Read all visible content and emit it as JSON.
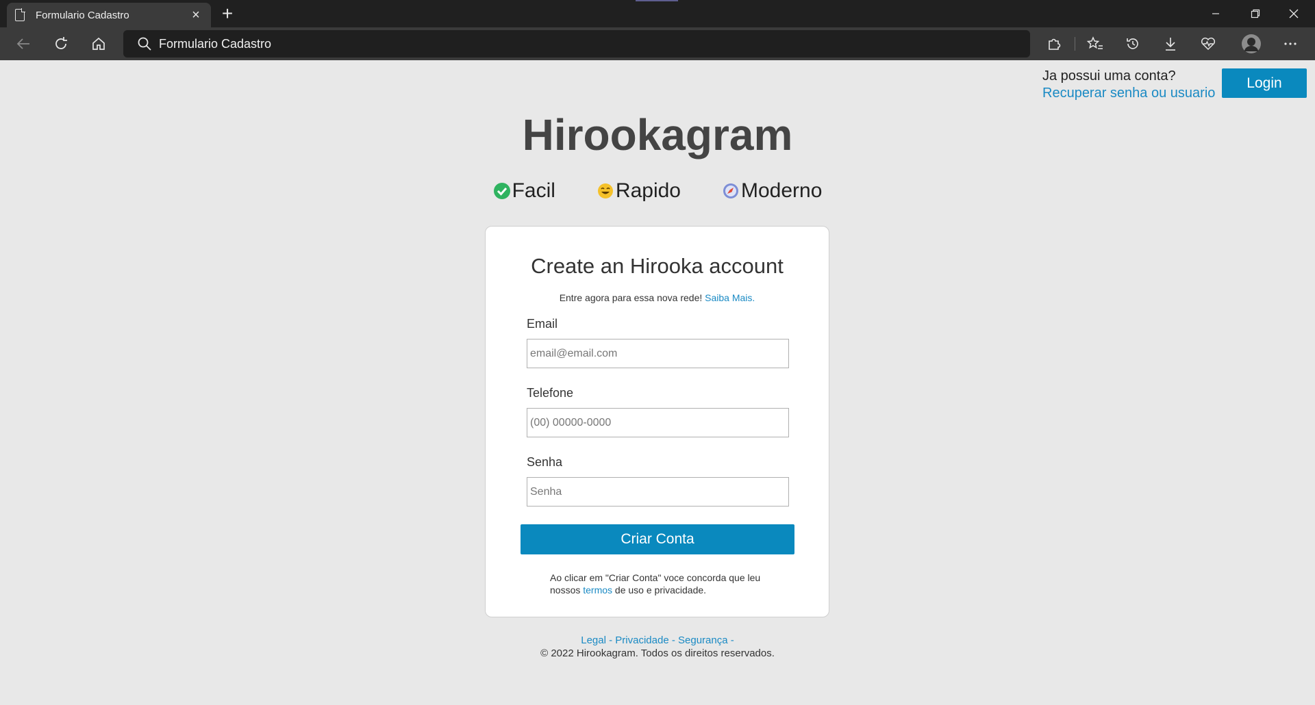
{
  "browser": {
    "tab_title": "Formulario Cadastro",
    "address_text": "Formulario Cadastro"
  },
  "header": {
    "question": "Ja possui uma conta?",
    "recover_link": "Recuperar senha ou usuario",
    "login_label": "Login"
  },
  "brand": "Hirookagram",
  "features": [
    {
      "label": "Facil",
      "icon": "check-circle-icon",
      "color": "#2fb360"
    },
    {
      "label": "Rapido",
      "icon": "smiley-icon",
      "color": "#f5c12a"
    },
    {
      "label": "Moderno",
      "icon": "compass-icon",
      "color": "#7d8ed6"
    }
  ],
  "form": {
    "title": "Create an Hirooka account",
    "subtitle": "Entre agora para essa nova rede! ",
    "subtitle_link": "Saiba Mais.",
    "email_label": "Email",
    "email_placeholder": "email@email.com",
    "phone_label": "Telefone",
    "phone_placeholder": "(00) 00000-0000",
    "password_label": "Senha",
    "password_placeholder": "Senha",
    "submit_label": "Criar Conta",
    "terms_before": "Ao clicar em \"Criar Conta\" voce concorda que leu nossos ",
    "terms_link": "termos",
    "terms_after": " de uso e privacidade."
  },
  "footer": {
    "links": [
      "Legal",
      "Privacidade",
      "Segurança"
    ],
    "copyright": "© 2022 Hirookagram. Todos os direitos reservados."
  },
  "colors": {
    "accent": "#0a89be",
    "link": "#1a8ac4",
    "page_bg": "#e8e8e8"
  }
}
